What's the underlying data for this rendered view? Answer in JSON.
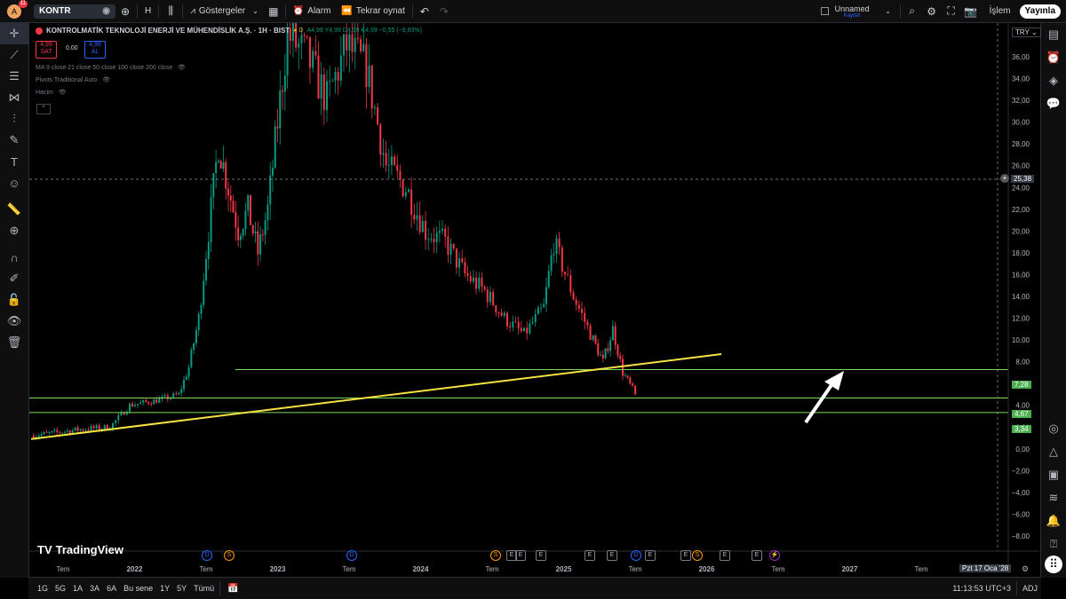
{
  "topbar": {
    "avatar_letter": "A",
    "notification_count": "11",
    "symbol": "KONTR",
    "interval": "H",
    "indicators_label": "Göstergeler",
    "alarm_label": "Alarm",
    "replay_label": "Tekrar oynat",
    "layout_name": "Unnamed",
    "layout_status": "Kaydet",
    "trade_label": "İşlem",
    "publish_label": "Yayınla"
  },
  "legend": {
    "title": "KONTROLMATİK TEKNOLOJİ ENERJİ VE MÜHENDİSLİK A.Ş. · 1H · BIST",
    "ohlc": "A4,99 Y4,99 D4,99 K4,99 −0,55 (−9,93%)",
    "sell_price": "4,99",
    "sell_label": "SAT",
    "spread": "0,00",
    "buy_price": "4,99",
    "buy_label": "AL",
    "ma_label": "MA 9 close 21 close 50 close 100 close 200 close",
    "pivots_label": "Pivots Traditional Auto",
    "volume_label": "Hacim"
  },
  "axis": {
    "currency": "TRY",
    "price_ticks": [
      "36,00",
      "34,00",
      "32,00",
      "30,00",
      "28,00",
      "26,00",
      "24,00",
      "22,00",
      "20,00",
      "18,00",
      "16,00",
      "14,00",
      "12,00",
      "10,00",
      "8,00",
      "6,00",
      "4,00",
      "2,00",
      "0,00",
      "−2,00",
      "−4,00",
      "−6,00",
      "−8,00"
    ],
    "time_ticks": [
      "Tem",
      "2022",
      "Tem",
      "2023",
      "Tem",
      "2024",
      "Tem",
      "2025",
      "Tem",
      "2026",
      "Tem",
      "2027",
      "Tem"
    ],
    "crosshair_price": "25,38",
    "crosshair_date": "Pzt 17 Oca '28",
    "level_tags": [
      "7,28",
      "4,67",
      "3,34"
    ]
  },
  "brand": "TradingView",
  "bottombar": {
    "ranges": [
      "1G",
      "5G",
      "1A",
      "3A",
      "6A",
      "Bu sene",
      "1Y",
      "5Y",
      "Tümü"
    ],
    "clock": "11:13:53 UTC+3",
    "adj": "ADJ"
  },
  "chart_data": {
    "type": "candlestick",
    "title": "KONTROLMATİK TEKNOLOJİ ENERJİ VE MÜHENDİSLİK A.Ş. · 1H · BIST",
    "ylim": [
      -8,
      38
    ],
    "horizontal_levels": [
      7.28,
      4.67,
      3.34
    ],
    "trendline": {
      "from": [
        "2021-05",
        0.9
      ],
      "to": [
        "2027-03",
        8.7
      ]
    },
    "approx_path": [
      [
        "2021-05",
        1.2
      ],
      [
        "2021-10",
        1.8
      ],
      [
        "2022-01",
        2.0
      ],
      [
        "2022-03",
        4.0
      ],
      [
        "2022-06",
        4.5
      ],
      [
        "2022-08",
        5.0
      ],
      [
        "2022-09",
        7.5
      ],
      [
        "2022-10",
        12.0
      ],
      [
        "2022-11",
        20.0
      ],
      [
        "2022-12",
        28.0
      ],
      [
        "2023-01",
        24.0
      ],
      [
        "2023-02",
        20.0
      ],
      [
        "2023-03",
        22.0
      ],
      [
        "2023-04",
        18.0
      ],
      [
        "2023-05",
        22.0
      ],
      [
        "2023-06",
        30.0
      ],
      [
        "2023-07",
        38.0
      ],
      [
        "2023-09",
        36.0
      ],
      [
        "2023-11",
        32.0
      ],
      [
        "2024-01",
        37.0
      ],
      [
        "2024-03",
        35.0
      ],
      [
        "2024-05",
        26.0
      ],
      [
        "2024-07",
        24.0
      ],
      [
        "2024-09",
        20.0
      ],
      [
        "2024-11",
        19.0
      ],
      [
        "2025-01",
        16.0
      ],
      [
        "2025-03",
        14.5
      ],
      [
        "2025-05",
        12.0
      ],
      [
        "2025-07",
        10.5
      ],
      [
        "2025-09",
        13.0
      ],
      [
        "2025-10",
        19.0
      ],
      [
        "2025-12",
        14.0
      ],
      [
        "2026-02",
        10.0
      ],
      [
        "2026-03",
        8.0
      ],
      [
        "2026-04",
        11.0
      ],
      [
        "2026-05",
        7.0
      ],
      [
        "2026-06",
        5.5
      ]
    ],
    "last_close": 4.99
  },
  "colors": {
    "up": "#089981",
    "down": "#f23645",
    "level": "#7ddc5b",
    "trendline": "#f5e342",
    "level_tag": "#4caf50"
  }
}
